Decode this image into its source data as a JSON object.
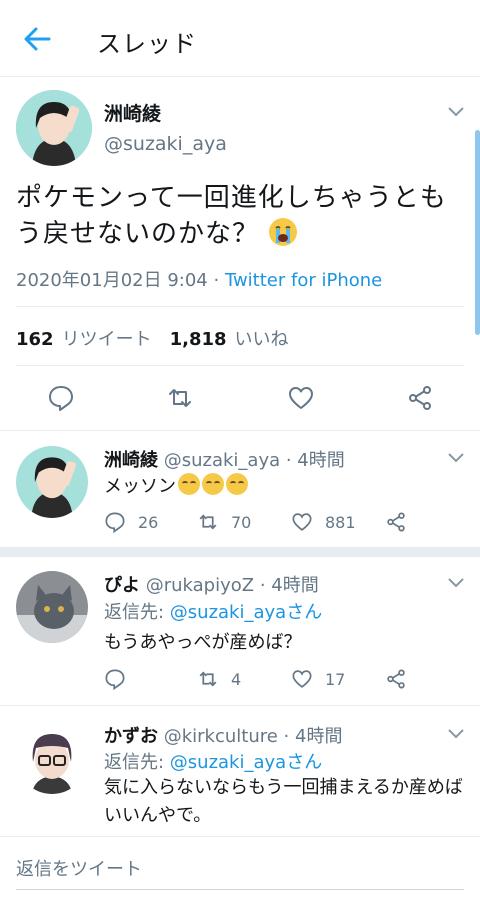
{
  "header": {
    "title": "スレッド"
  },
  "main_tweet": {
    "name": "洲崎綾",
    "handle": "@suzaki_aya",
    "text": "ポケモンって一回進化しちゃうともう戻せないのかな？",
    "date": "2020年01月02日 9:04 · ",
    "source": "Twitter for iPhone",
    "retweet_count": "162",
    "retweet_label": "リツイート",
    "like_count": "1,818",
    "like_label": "いいね"
  },
  "replies": [
    {
      "name": "洲崎綾",
      "handle_time": "@suzaki_aya · 4時間",
      "text": "メッソン",
      "reply_count": "26",
      "retweet_count": "70",
      "like_count": "881"
    },
    {
      "name": "ぴよ",
      "handle_time": "@rukapiyoZ · 4時間",
      "reply_to_label": "返信先: ",
      "reply_to_handle": "@suzaki_ayaさん",
      "text": "もうあやっぺが産めば？",
      "reply_count": "",
      "retweet_count": "4",
      "like_count": "17"
    },
    {
      "name": "かずお",
      "handle_time": "@kirkculture · 4時間",
      "reply_to_label": "返信先: ",
      "reply_to_handle": "@suzaki_ayaさん",
      "text": "気に入らないならもう一回捕まえるか産めばいいんやで。"
    }
  ],
  "composer": {
    "placeholder": "返信をツイート"
  },
  "colors": {
    "accent": "#1da1f2",
    "text": "#14171a",
    "muted": "#657786",
    "divider": "#e6ecf0"
  },
  "icons": [
    "back-arrow-icon",
    "chevron-down-icon",
    "reply-icon",
    "retweet-icon",
    "like-icon",
    "share-icon",
    "crying-emoji-icon",
    "relieved-emoji-icon"
  ]
}
